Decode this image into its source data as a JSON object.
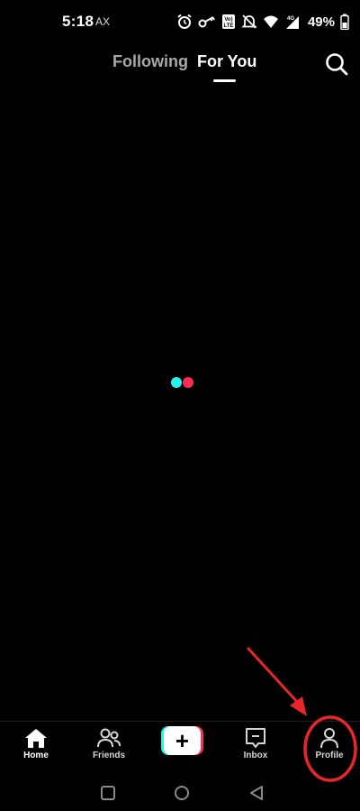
{
  "status_bar": {
    "time": "5:18",
    "carrier": "AX",
    "network": "4G",
    "battery": "49%",
    "icons": [
      "alarm-icon",
      "vpn-key-icon",
      "volte-icon",
      "mute-icon",
      "wifi-icon",
      "signal-icon",
      "battery-icon"
    ]
  },
  "top_nav": {
    "tabs": [
      {
        "label": "Following",
        "active": false
      },
      {
        "label": "For You",
        "active": true
      }
    ],
    "search_icon": "search-icon"
  },
  "loader": {
    "colors": [
      "#25f4ee",
      "#fe2c55"
    ]
  },
  "bottom_nav": {
    "items": [
      {
        "label": "Home",
        "icon": "home-icon",
        "active": true
      },
      {
        "label": "Friends",
        "icon": "friends-icon",
        "active": false
      },
      {
        "label": "Inbox",
        "icon": "inbox-icon",
        "active": false
      },
      {
        "label": "Profile",
        "icon": "profile-icon",
        "active": false
      }
    ],
    "create_icon": "plus-icon"
  },
  "annotation": {
    "color": "#e8262a"
  },
  "system_nav": {
    "buttons": [
      "recents-button",
      "home-button",
      "back-button"
    ]
  },
  "colors": {
    "accent_cyan": "#25f4ee",
    "accent_red": "#fe2c55",
    "background": "#000000"
  }
}
